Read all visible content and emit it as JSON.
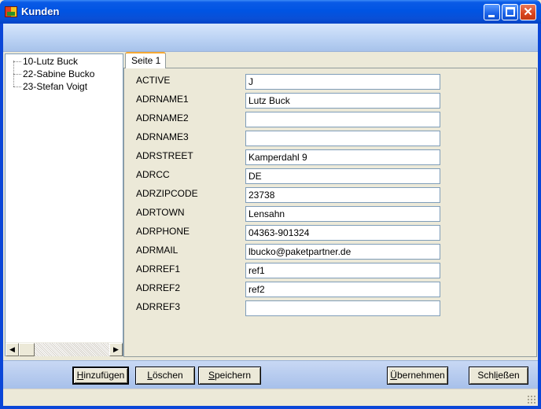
{
  "window": {
    "title": "Kunden",
    "minimize_icon": "minimize-icon",
    "maximize_icon": "maximize-icon",
    "close_icon": "close-icon"
  },
  "tree": {
    "items": [
      {
        "label": "10-Lutz Buck"
      },
      {
        "label": "22-Sabine Bucko"
      },
      {
        "label": "23-Stefan Voigt"
      }
    ]
  },
  "tabs": [
    {
      "label": "Seite 1",
      "selected": true
    }
  ],
  "fields": [
    {
      "label": "ACTIVE",
      "value": "J"
    },
    {
      "label": "ADRNAME1",
      "value": "Lutz Buck"
    },
    {
      "label": "ADRNAME2",
      "value": ""
    },
    {
      "label": "ADRNAME3",
      "value": ""
    },
    {
      "label": "ADRSTREET",
      "value": "Kamperdahl 9"
    },
    {
      "label": "ADRCC",
      "value": "DE"
    },
    {
      "label": "ADRZIPCODE",
      "value": "23738"
    },
    {
      "label": "ADRTOWN",
      "value": "Lensahn"
    },
    {
      "label": "ADRPHONE",
      "value": "04363-901324"
    },
    {
      "label": "ADRMAIL",
      "value": "lbucko@paketpartner.de"
    },
    {
      "label": "ADRREF1",
      "value": "ref1"
    },
    {
      "label": "ADRREF2",
      "value": "ref2"
    },
    {
      "label": "ADRREF3",
      "value": ""
    }
  ],
  "buttons": {
    "add": {
      "mnemonic": "H",
      "rest": "inzufügen"
    },
    "delete": {
      "mnemonic": "L",
      "rest": "öschen"
    },
    "save": {
      "mnemonic": "S",
      "rest": "peichern"
    },
    "apply": {
      "mnemonic": "Ü",
      "rest": "bernehmen"
    },
    "close": {
      "mnemonic": "",
      "pre": "Schl",
      "mnem_mid": "i",
      "post": "eßen"
    }
  },
  "colors": {
    "titlebar": "#0054e3",
    "tab_accent": "#f5a833",
    "input_border": "#7f9db9"
  }
}
